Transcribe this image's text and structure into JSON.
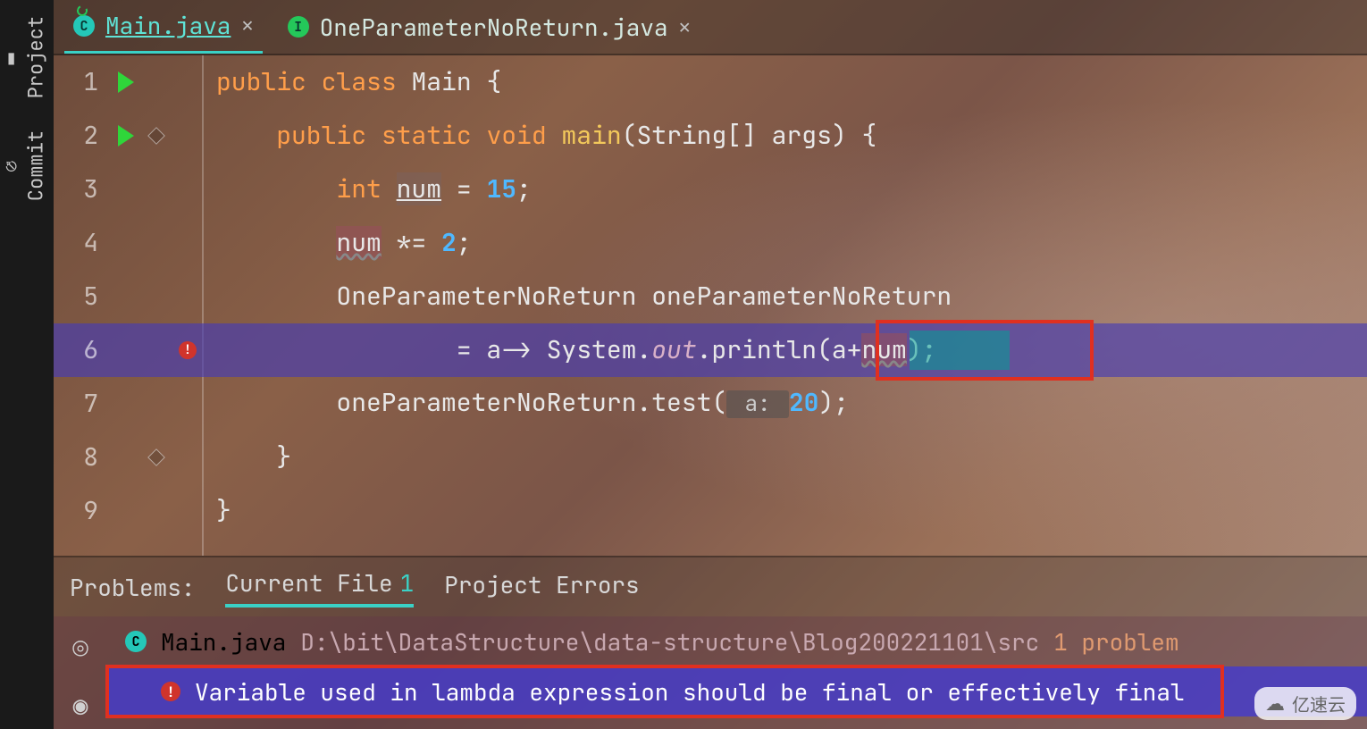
{
  "rail": {
    "project": "Project",
    "commit": "Commit"
  },
  "tabs": [
    {
      "badge": "C",
      "name": "Main.java",
      "active": true
    },
    {
      "badge": "I",
      "name": "OneParameterNoReturn.java",
      "active": false
    }
  ],
  "code": {
    "lines": [
      "1",
      "2",
      "3",
      "4",
      "5",
      "6",
      "7",
      "8",
      "9"
    ],
    "l1_kw1": "public",
    "l1_kw2": "class",
    "l1_cls": "Main",
    "l1_brace": " {",
    "l2_kw1": "public",
    "l2_kw2": "static",
    "l2_kw3": "void",
    "l2_fn": "main",
    "l2_sig": "(String[] args) {",
    "l3_kw": "int",
    "l3_var": "num",
    "l3_eq": " = ",
    "l3_val": "15",
    "l3_semi": ";",
    "l4_var": "num",
    "l4_op": " *= ",
    "l4_val": "2",
    "l4_semi": ";",
    "l5_type": "OneParameterNoReturn oneParameterNoReturn",
    "l6_pre": "= a-> System.",
    "l6_out": "out",
    "l6_mid": ".println",
    "l6_open": "(",
    "l6_arg_a": "a+",
    "l6_arg_num": "num",
    "l6_close": ")",
    "l6_semi": ";",
    "l7_call": "oneParameterNoReturn.test(",
    "l7_hint": " a: ",
    "l7_val": "20",
    "l7_end": ");",
    "l8": "}",
    "l9": "}"
  },
  "problems": {
    "label": "Problems:",
    "tab_current": "Current File",
    "tab_current_count": "1",
    "tab_project": "Project Errors"
  },
  "details": {
    "file": "Main.java",
    "path": "D:\\bit\\DataStructure\\data-structure\\Blog200221101\\src",
    "count": "1 problem",
    "error": "Variable used in lambda expression should be final or effectively final"
  },
  "watermark": "亿速云"
}
